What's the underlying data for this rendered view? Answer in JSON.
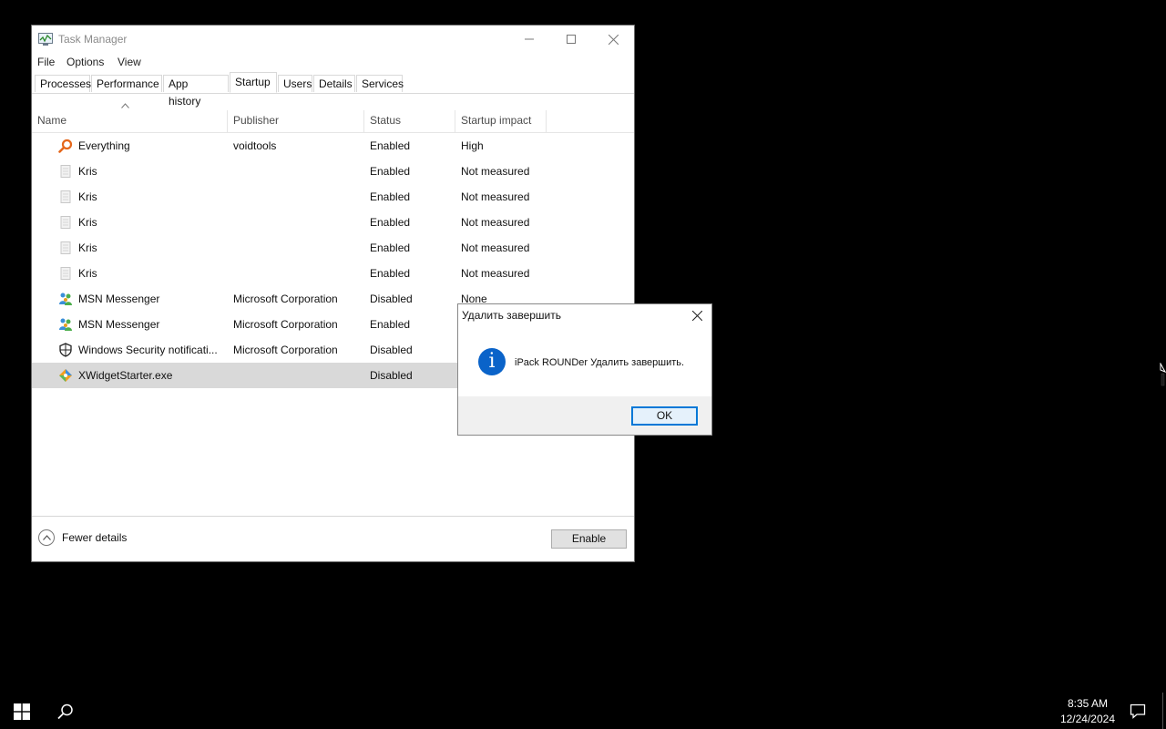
{
  "window": {
    "title": "Task Manager",
    "menu": [
      "File",
      "Options",
      "View"
    ],
    "tabs": [
      "Processes",
      "Performance",
      "App history",
      "Startup",
      "Users",
      "Details",
      "Services"
    ],
    "active_tab": "Startup",
    "columns": [
      "Name",
      "Publisher",
      "Status",
      "Startup impact"
    ],
    "sorted_column": "Name",
    "rows": [
      {
        "name": "Everything",
        "publisher": "voidtools",
        "status": "Enabled",
        "impact": "High",
        "icon": "magnifier-icon"
      },
      {
        "name": "Kris",
        "publisher": "",
        "status": "Enabled",
        "impact": "Not measured",
        "icon": "blank-file-icon"
      },
      {
        "name": "Kris",
        "publisher": "",
        "status": "Enabled",
        "impact": "Not measured",
        "icon": "blank-file-icon"
      },
      {
        "name": "Kris",
        "publisher": "",
        "status": "Enabled",
        "impact": "Not measured",
        "icon": "blank-file-icon"
      },
      {
        "name": "Kris",
        "publisher": "",
        "status": "Enabled",
        "impact": "Not measured",
        "icon": "blank-file-icon"
      },
      {
        "name": "Kris",
        "publisher": "",
        "status": "Enabled",
        "impact": "Not measured",
        "icon": "blank-file-icon"
      },
      {
        "name": "MSN Messenger",
        "publisher": "Microsoft Corporation",
        "status": "Disabled",
        "impact": "None",
        "icon": "msn-buddy-icon"
      },
      {
        "name": "MSN Messenger",
        "publisher": "Microsoft Corporation",
        "status": "Enabled",
        "impact": "",
        "icon": "msn-buddy-icon"
      },
      {
        "name": "Windows Security notificati...",
        "publisher": "Microsoft Corporation",
        "status": "Disabled",
        "impact": "",
        "icon": "shield-icon"
      },
      {
        "name": "XWidgetStarter.exe",
        "publisher": "",
        "status": "Disabled",
        "impact": "",
        "icon": "xwidget-icon",
        "selected": true
      }
    ],
    "footer": {
      "fewer_details": "Fewer details",
      "enable_button": "Enable"
    }
  },
  "dialog": {
    "title": "Удалить завершить",
    "message": "iPack ROUNDer Удалить завершить.",
    "ok": "OK",
    "icon": "info-icon"
  },
  "taskbar": {
    "time": "8:35 AM",
    "date": "12/24/2024"
  }
}
